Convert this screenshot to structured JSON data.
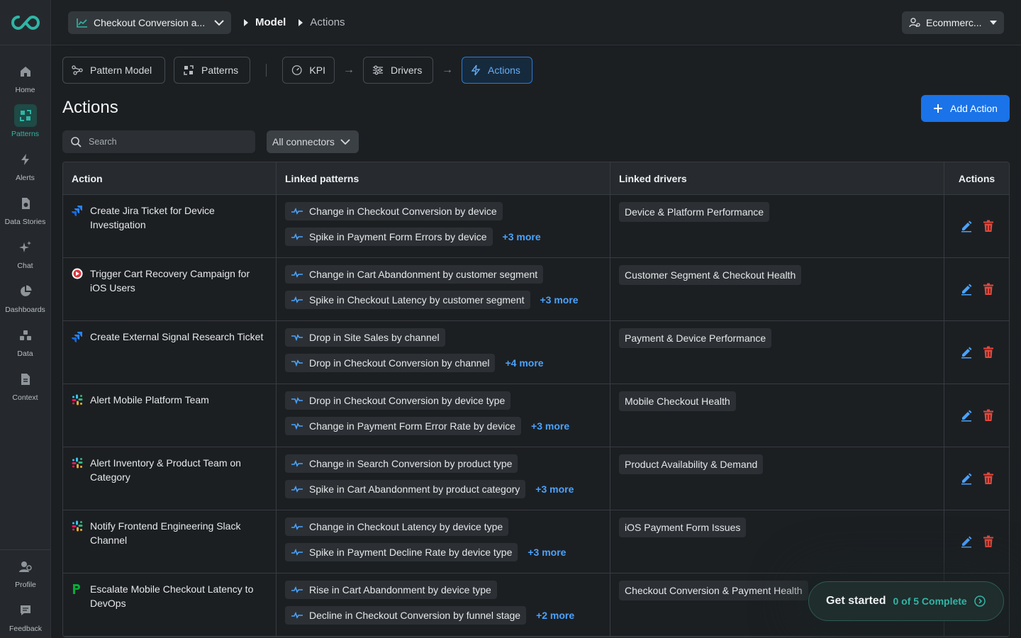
{
  "sidebar": {
    "items": [
      {
        "label": "Home",
        "icon": "home-icon"
      },
      {
        "label": "Patterns",
        "icon": "patterns-icon",
        "active": true
      },
      {
        "label": "Alerts",
        "icon": "bolt-icon"
      },
      {
        "label": "Data Stories",
        "icon": "data-stories-icon"
      },
      {
        "label": "Chat",
        "icon": "sparkle-icon"
      },
      {
        "label": "Dashboards",
        "icon": "pie-icon"
      },
      {
        "label": "Data",
        "icon": "data-icon"
      },
      {
        "label": "Context",
        "icon": "document-icon"
      }
    ],
    "bottom": [
      {
        "label": "Profile",
        "icon": "profile-icon"
      },
      {
        "label": "Feedback",
        "icon": "feedback-icon"
      }
    ]
  },
  "topbar": {
    "kpi_select": "Checkout Conversion a...",
    "crumb_model": "Model",
    "crumb_actions": "Actions",
    "workspace": "Ecommerc..."
  },
  "tabs": {
    "pattern_model": "Pattern Model",
    "patterns": "Patterns",
    "kpi": "KPI",
    "drivers": "Drivers",
    "actions": "Actions"
  },
  "page": {
    "title": "Actions",
    "add_action": "Add Action",
    "search_placeholder": "Search",
    "connector_filter": "All connectors"
  },
  "table": {
    "headers": [
      "Action",
      "Linked patterns",
      "Linked drivers",
      "Actions"
    ],
    "rows": [
      {
        "connector": "jira",
        "action": "Create Jira Ticket for Device Investigation",
        "patterns": [
          "Change in Checkout Conversion by device",
          "Spike in Payment Form Errors by device"
        ],
        "more": "+3 more",
        "driver": "Device & Platform Performance"
      },
      {
        "connector": "campaign",
        "action": "Trigger Cart Recovery Campaign for iOS Users",
        "patterns": [
          "Change in Cart Abandonment by customer segment",
          "Spike in Checkout Latency by customer segment"
        ],
        "more": "+3 more",
        "driver": "Customer Segment & Checkout Health"
      },
      {
        "connector": "jira",
        "action": "Create External Signal Research Ticket",
        "patterns": [
          "Drop in Site Sales by channel",
          "Drop in Checkout Conversion by channel"
        ],
        "more": "+4 more",
        "driver": "Payment & Device Performance"
      },
      {
        "connector": "slack",
        "action": "Alert Mobile Platform Team",
        "patterns": [
          "Drop in Checkout Conversion by device type",
          "Change in Payment Form Error Rate by device"
        ],
        "more": "+3 more",
        "driver": "Mobile Checkout Health"
      },
      {
        "connector": "slack",
        "action": "Alert Inventory & Product Team on Category",
        "patterns": [
          "Change in Search Conversion by product type",
          "Spike in Cart Abandonment by product category"
        ],
        "more": "+3 more",
        "driver": "Product Availability & Demand"
      },
      {
        "connector": "slack",
        "action": "Notify Frontend Engineering Slack Channel",
        "patterns": [
          "Change in Checkout Latency by device type",
          "Spike in Payment Decline Rate by device type"
        ],
        "more": "+3 more",
        "driver": "iOS Payment Form Issues"
      },
      {
        "connector": "pagerduty",
        "action": "Escalate Mobile Checkout Latency to DevOps",
        "patterns": [
          "Rise in Cart Abandonment by device type",
          "Decline in Checkout Conversion by funnel stage"
        ],
        "more": "+2 more",
        "driver": "Checkout Conversion & Payment Health"
      }
    ]
  },
  "get_started": {
    "title": "Get started",
    "progress": "0 of 5 Complete"
  },
  "colors": {
    "accent_teal": "#2fb6a6",
    "primary_blue": "#1a73e8",
    "link_blue": "#4aa3ff",
    "delete_red": "#e5483c",
    "edit_blue": "#4aa3ff"
  }
}
